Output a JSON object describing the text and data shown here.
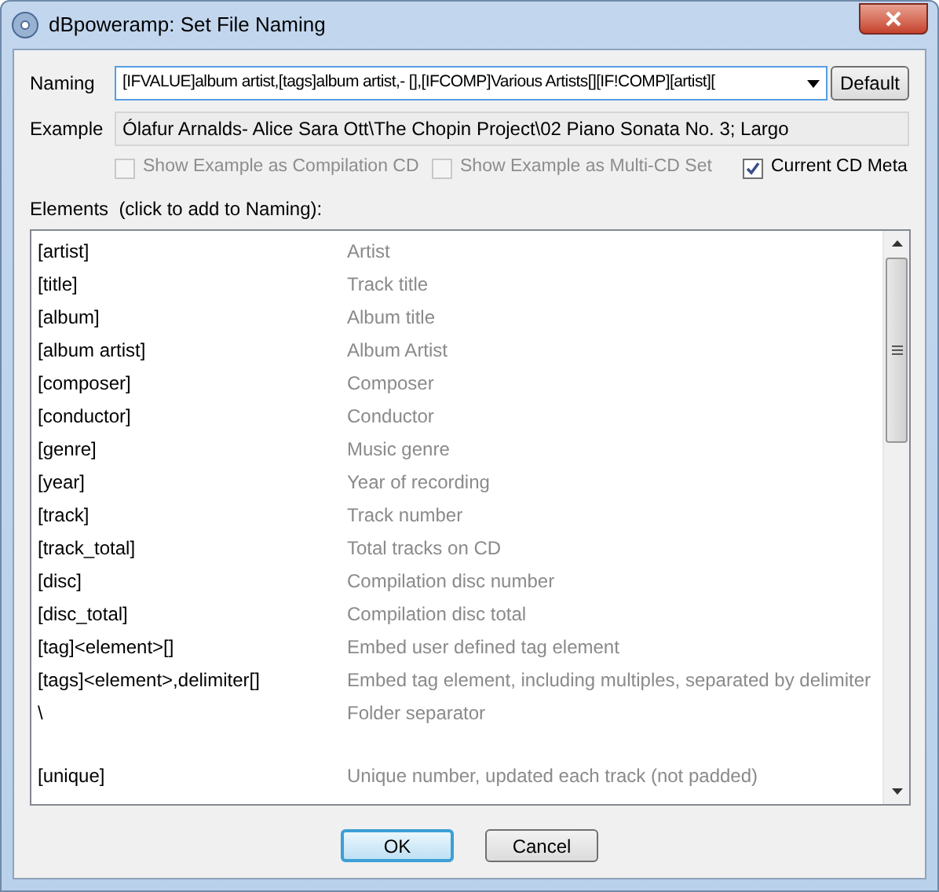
{
  "window": {
    "title": "dBpoweramp: Set File Naming"
  },
  "naming": {
    "label": "Naming",
    "value": "[IFVALUE]album artist,[tags]album artist,- [],[IFCOMP]Various Artists[][IF!COMP][artist][",
    "button": "Default"
  },
  "example": {
    "label": "Example",
    "value": "Ólafur Arnalds- Alice Sara Ott\\The Chopin Project\\02 Piano Sonata No. 3; Largo"
  },
  "options": [
    {
      "label": "Show Example as Compilation CD",
      "checked": false,
      "disabled": true
    },
    {
      "label": "Show Example as Multi-CD Set",
      "checked": false,
      "disabled": true
    },
    {
      "label": "Current CD Meta",
      "checked": true,
      "disabled": false
    }
  ],
  "elements": {
    "label": "Elements  (click to add to Naming):",
    "rows": [
      {
        "code": "[artist]",
        "description": "Artist"
      },
      {
        "code": "[title]",
        "description": "Track title"
      },
      {
        "code": "[album]",
        "description": "Album title"
      },
      {
        "code": "[album artist]",
        "description": "Album Artist"
      },
      {
        "code": "[composer]",
        "description": "Composer"
      },
      {
        "code": "[conductor]",
        "description": "Conductor"
      },
      {
        "code": "[genre]",
        "description": "Music genre"
      },
      {
        "code": "[year]",
        "description": "Year of recording"
      },
      {
        "code": "[track]",
        "description": "Track number"
      },
      {
        "code": "[track_total]",
        "description": "Total tracks on CD"
      },
      {
        "code": "[disc]",
        "description": "Compilation disc number"
      },
      {
        "code": "[disc_total]",
        "description": "Compilation disc total"
      },
      {
        "code": "[tag]<element>[]",
        "description": "Embed user defined tag element"
      },
      {
        "code": "[tags]<element>,delimiter[]",
        "description": "Embed tag element, including multiples, separated by delimiter"
      },
      {
        "code": "\\",
        "description": "Folder separator"
      },
      {
        "code": "[unique]",
        "description": "Unique number, updated each track (not padded)",
        "gap_before": true
      }
    ]
  },
  "buttons": [
    {
      "label": "OK",
      "default": true
    },
    {
      "label": "Cancel",
      "default": false
    }
  ]
}
